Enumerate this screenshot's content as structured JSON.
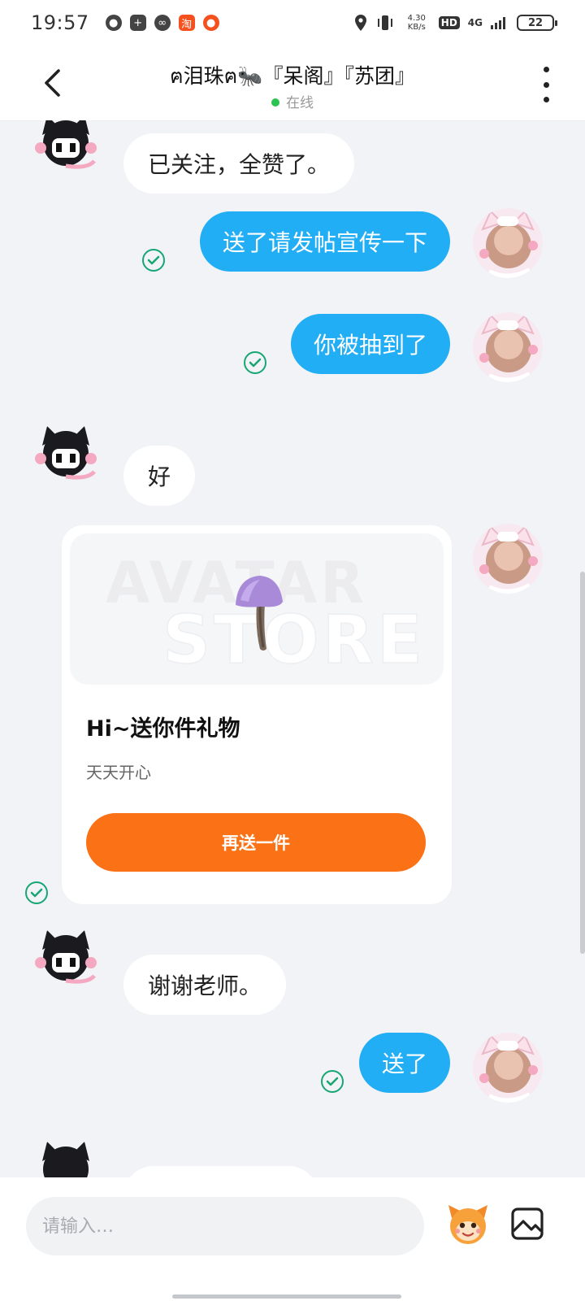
{
  "status_bar": {
    "time": "19:57",
    "network_speed": "4.30 KB/s",
    "hd_label": "HD",
    "signal_label": "4G",
    "battery": "22"
  },
  "header": {
    "title": "ฅ泪珠ฅ🐜『呆阁』『苏团』",
    "status": "在线"
  },
  "messages": [
    {
      "side": "in",
      "text": "已关注，全赞了。"
    },
    {
      "side": "out",
      "text": "送了请发帖宣传一下"
    },
    {
      "side": "out",
      "text": "你被抽到了"
    },
    {
      "side": "in",
      "text": "好"
    },
    {
      "side": "in",
      "text": "谢谢老师。"
    },
    {
      "side": "out",
      "text": "送了"
    }
  ],
  "gift_card": {
    "watermark_line1": "AVATAR",
    "watermark_line2": "STORE",
    "title": "Hi~送你件礼物",
    "subtitle": "天天开心",
    "button_label": "再送一件"
  },
  "input": {
    "placeholder": "请输入…"
  },
  "colors": {
    "outgoing_bubble": "#22aef4",
    "incoming_bubble": "#ffffff",
    "accent_orange": "#fb7115",
    "read_check": "#17a673",
    "online_dot": "#2bc450"
  },
  "icons": {
    "back": "chevron-left-icon",
    "more": "more-vertical-icon",
    "read": "check-circle-icon",
    "sticker": "mascot-icon",
    "image": "image-icon"
  }
}
